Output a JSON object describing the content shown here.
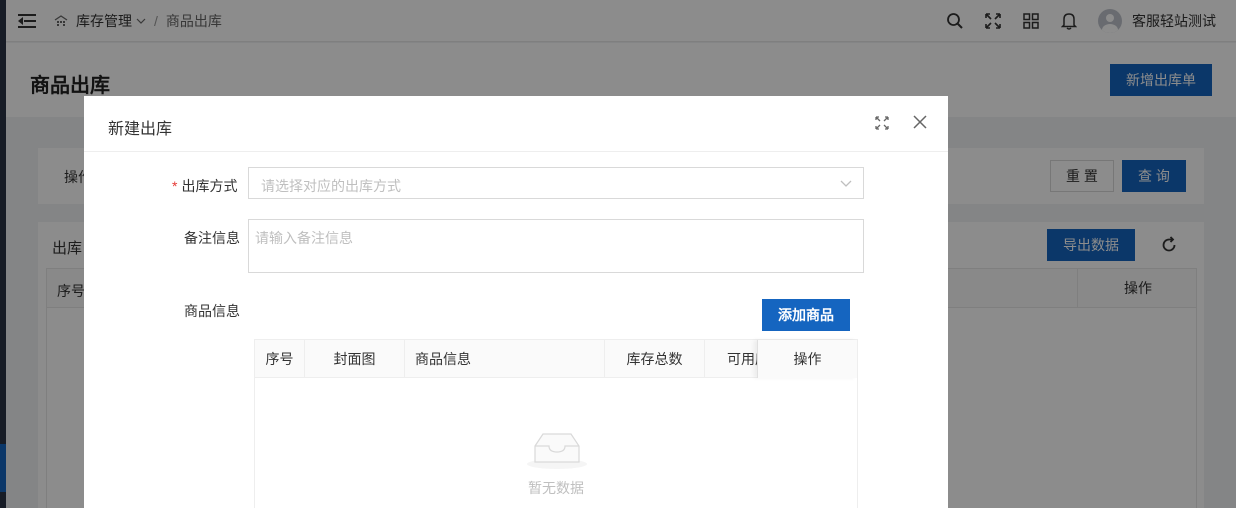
{
  "header": {
    "breadcrumb_parent": "库存管理",
    "breadcrumb_current": "商品出库",
    "user_name": "客服轻站测试"
  },
  "page": {
    "title": "商品出库",
    "new_button": "新增出库单"
  },
  "filter": {
    "label_partial": "操作",
    "reset_button": "重 置",
    "query_button": "查 询"
  },
  "list": {
    "label_partial": "出库",
    "export_button": "导出数据",
    "col_index": "序号",
    "col_actions": "操作"
  },
  "modal": {
    "title": "新建出库",
    "required_mark": "*",
    "outbound_method_label": "出库方式",
    "outbound_method_placeholder": "请选择对应的出库方式",
    "remark_label": "备注信息",
    "remark_placeholder": "请输入备注信息",
    "goods_label": "商品信息",
    "add_goods_button": "添加商品",
    "goods_table": {
      "columns": [
        "序号",
        "封面图",
        "商品信息",
        "库存总数",
        "可用库",
        "操作"
      ],
      "empty_text": "暂无数据"
    }
  },
  "colors": {
    "primary": "#1565c0",
    "required": "#e53935",
    "placeholder": "#bfbfbf"
  }
}
